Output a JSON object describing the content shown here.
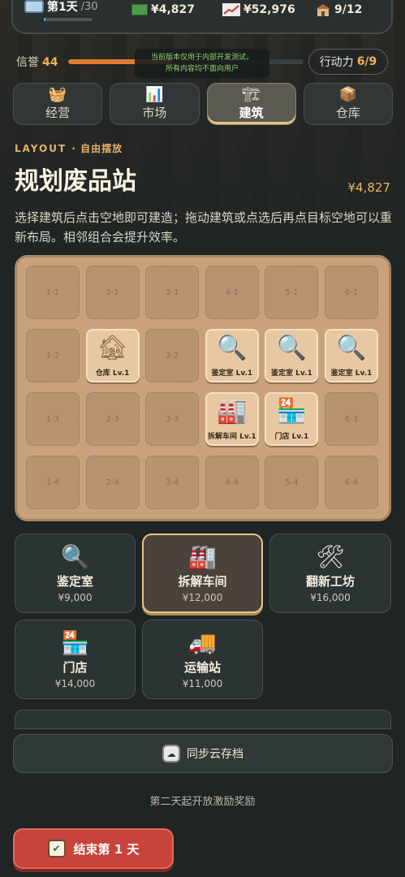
{
  "header": {
    "day_label": "第1天",
    "day_total": "/30",
    "day_progress": 0.033,
    "cash": "¥4,827",
    "net_worth": "¥52,976",
    "capacity": "9/12",
    "icons": {
      "calendar": "calendar-icon",
      "cash": "cash-icon",
      "trend": "trend-up-icon",
      "warehouse": "house-icon"
    }
  },
  "status": {
    "reputation_label": "信誉",
    "reputation_value": "44",
    "reputation_progress": 0.44,
    "notice_line1": "当前版本仅用于内部开发测试，",
    "notice_line2": "所有内容均不面向用户",
    "action_label": "行动力",
    "action_value": "6/9"
  },
  "tabs": [
    {
      "label": "经营",
      "icon": "🧺",
      "active": false
    },
    {
      "label": "市场",
      "icon": "📊",
      "active": false
    },
    {
      "label": "建筑",
      "icon": "🏗",
      "active": true
    },
    {
      "label": "仓库",
      "icon": "📦",
      "active": false
    }
  ],
  "layout_section": {
    "kicker": "LAYOUT",
    "kicker_sub": "· 自由摆放",
    "title": "规划废品站",
    "money": "¥4,827",
    "description": "选择建筑后点击空地即可建造；拖动建筑或点选后再点目标空地可以重新布局。相邻组合会提升效率。"
  },
  "grid": {
    "columns": 6,
    "rows": 4,
    "cells": [
      {
        "id": "1-1"
      },
      {
        "id": "2-1"
      },
      {
        "id": "3-1"
      },
      {
        "id": "4-1"
      },
      {
        "id": "5-1"
      },
      {
        "id": "6-1"
      },
      {
        "id": "1-2"
      },
      {
        "id": "2-2",
        "building": "仓库 Lv.1",
        "icon": "🏚"
      },
      {
        "id": "3-2"
      },
      {
        "id": "4-2",
        "building": "鉴定室 Lv.1",
        "icon": "🔍"
      },
      {
        "id": "5-2",
        "building": "鉴定室 Lv.1",
        "icon": "🔍"
      },
      {
        "id": "6-2",
        "building": "鉴定室 Lv.1",
        "icon": "🔍"
      },
      {
        "id": "1-3"
      },
      {
        "id": "2-3"
      },
      {
        "id": "3-3"
      },
      {
        "id": "4-3",
        "building": "拆解车间 Lv.1",
        "icon": "🏭"
      },
      {
        "id": "5-3",
        "building": "门店 Lv.1",
        "icon": "🏪"
      },
      {
        "id": "6-3"
      },
      {
        "id": "1-4"
      },
      {
        "id": "2-4"
      },
      {
        "id": "3-4"
      },
      {
        "id": "4-4"
      },
      {
        "id": "5-4"
      },
      {
        "id": "6-4"
      }
    ]
  },
  "buildings": [
    {
      "name": "鉴定室",
      "price": "¥9,000",
      "icon": "🔍",
      "selected": false
    },
    {
      "name": "拆解车间",
      "price": "¥12,000",
      "icon": "🏭",
      "selected": true
    },
    {
      "name": "翻新工坊",
      "price": "¥16,000",
      "icon": "🛠",
      "selected": false
    },
    {
      "name": "门店",
      "price": "¥14,000",
      "icon": "🏪",
      "selected": false
    },
    {
      "name": "运输站",
      "price": "¥11,000",
      "icon": "🚚",
      "selected": false
    }
  ],
  "footer": {
    "sync_label": "同步云存档",
    "sync_icon": "☁",
    "hint": "第二天起开放激励奖励",
    "end_label": "结束第 1 天",
    "end_icon": "✔"
  },
  "colors": {
    "accent": "#e6c58a",
    "reputation_bar": "#e07a33",
    "end_button": "#c7443a",
    "board": "#c9a27c"
  }
}
